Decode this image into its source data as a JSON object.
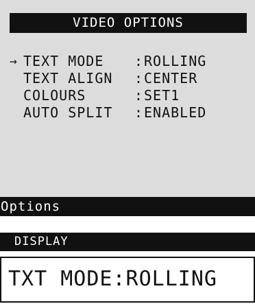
{
  "screen": {
    "title": "VIDEO OPTIONS",
    "cursor_glyph": "→",
    "selected_index": 0,
    "menu_items": [
      {
        "label": "TEXT MODE",
        "separator": ":",
        "value": "ROLLING"
      },
      {
        "label": "TEXT ALIGN",
        "separator": ":",
        "value": "CENTER"
      },
      {
        "label": "COLOURS",
        "separator": ":",
        "value": "SET1"
      },
      {
        "label": "AUTO SPLIT",
        "separator": ":",
        "value": "ENABLED"
      }
    ],
    "footer_label": "Options"
  },
  "display": {
    "header": "DISPLAY",
    "text": "TXT MODE:ROLLING"
  },
  "colors": {
    "screen_background": "#dcdcdc",
    "bar_background": "#111111",
    "bar_text": "#ffffff",
    "text": "#111111"
  }
}
